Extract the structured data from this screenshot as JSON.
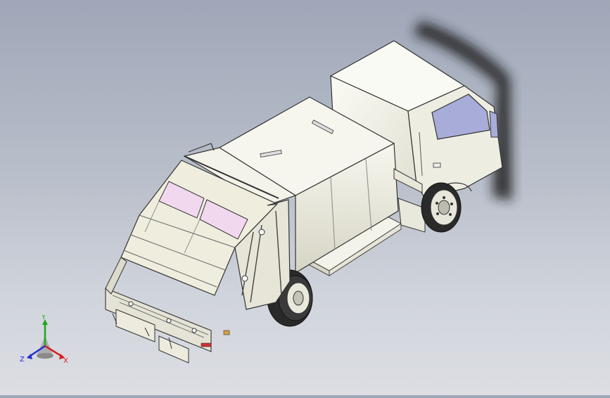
{
  "triad": {
    "y_label": "Y",
    "x_label": "X",
    "z_label": "Z",
    "colors": {
      "x": "#d42020",
      "y": "#1ea81e",
      "z": "#2030d0"
    }
  },
  "scene": {
    "model": "refuse-compactor-truck",
    "colors": {
      "body": "#f2f1e8",
      "body_shade": "#d9d8c8",
      "outline": "#303030",
      "glass": "#a8acd8",
      "panel_pink": "#f1d8ef",
      "tire": "#2a2a2a",
      "shadow": "#1e1e1e"
    }
  }
}
